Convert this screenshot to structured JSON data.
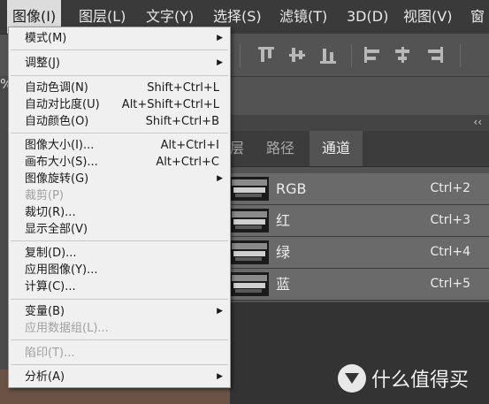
{
  "menubar": {
    "items": [
      {
        "label": "图像(I)"
      },
      {
        "label": "图层(L)"
      },
      {
        "label": "文字(Y)"
      },
      {
        "label": "选择(S)"
      },
      {
        "label": "滤镜(T)"
      },
      {
        "label": "3D(D)"
      },
      {
        "label": "视图(V)"
      },
      {
        "label": "窗"
      }
    ]
  },
  "percent_fragment": "%",
  "menu": {
    "items": [
      {
        "label": "模式(M)",
        "shortcut": "",
        "submenu": true,
        "disabled": false
      },
      {
        "label": "调整(J)",
        "shortcut": "",
        "submenu": true,
        "disabled": false
      },
      {
        "label": "自动色调(N)",
        "shortcut": "Shift+Ctrl+L",
        "submenu": false,
        "disabled": false
      },
      {
        "label": "自动对比度(U)",
        "shortcut": "Alt+Shift+Ctrl+L",
        "submenu": false,
        "disabled": false
      },
      {
        "label": "自动颜色(O)",
        "shortcut": "Shift+Ctrl+B",
        "submenu": false,
        "disabled": false
      },
      {
        "label": "图像大小(I)...",
        "shortcut": "Alt+Ctrl+I",
        "submenu": false,
        "disabled": false
      },
      {
        "label": "画布大小(S)...",
        "shortcut": "Alt+Ctrl+C",
        "submenu": false,
        "disabled": false
      },
      {
        "label": "图像旋转(G)",
        "shortcut": "",
        "submenu": true,
        "disabled": false
      },
      {
        "label": "裁剪(P)",
        "shortcut": "",
        "submenu": false,
        "disabled": true
      },
      {
        "label": "裁切(R)...",
        "shortcut": "",
        "submenu": false,
        "disabled": false
      },
      {
        "label": "显示全部(V)",
        "shortcut": "",
        "submenu": false,
        "disabled": false
      },
      {
        "label": "复制(D)...",
        "shortcut": "",
        "submenu": false,
        "disabled": false
      },
      {
        "label": "应用图像(Y)...",
        "shortcut": "",
        "submenu": false,
        "disabled": false
      },
      {
        "label": "计算(C)...",
        "shortcut": "",
        "submenu": false,
        "disabled": false
      },
      {
        "label": "变量(B)",
        "shortcut": "",
        "submenu": true,
        "disabled": false
      },
      {
        "label": "应用数据组(L)...",
        "shortcut": "",
        "submenu": false,
        "disabled": true
      },
      {
        "label": "陷印(T)...",
        "shortcut": "",
        "submenu": false,
        "disabled": true
      },
      {
        "label": "分析(A)",
        "shortcut": "",
        "submenu": true,
        "disabled": false
      }
    ]
  },
  "panel": {
    "collapse_glyph": "‹‹",
    "tabs": [
      {
        "label": "层"
      },
      {
        "label": "路径"
      },
      {
        "label": "通道"
      }
    ],
    "active_tab": "通道",
    "channels": [
      {
        "name": "RGB",
        "shortcut": "Ctrl+2"
      },
      {
        "name": "红",
        "shortcut": "Ctrl+3"
      },
      {
        "name": "绿",
        "shortcut": "Ctrl+4"
      },
      {
        "name": "蓝",
        "shortcut": "Ctrl+5"
      }
    ]
  },
  "watermark": {
    "text": "什么值得买"
  },
  "icons": {
    "submenu": "submenu-arrow-icon",
    "align": [
      "align-top-icon",
      "align-vcenter-icon",
      "align-bottom-icon",
      "align-left-icon",
      "align-hcenter-icon",
      "align-right-icon"
    ],
    "collapse": "collapse-panel-icon",
    "logo": "smzdm-logo-icon"
  },
  "colors": {
    "menubar_bg": "#3a3a3a",
    "menu_bg": "#f0f0f0",
    "panel_bg": "#535353",
    "selected_channel_bg": "#6a6a6a"
  }
}
